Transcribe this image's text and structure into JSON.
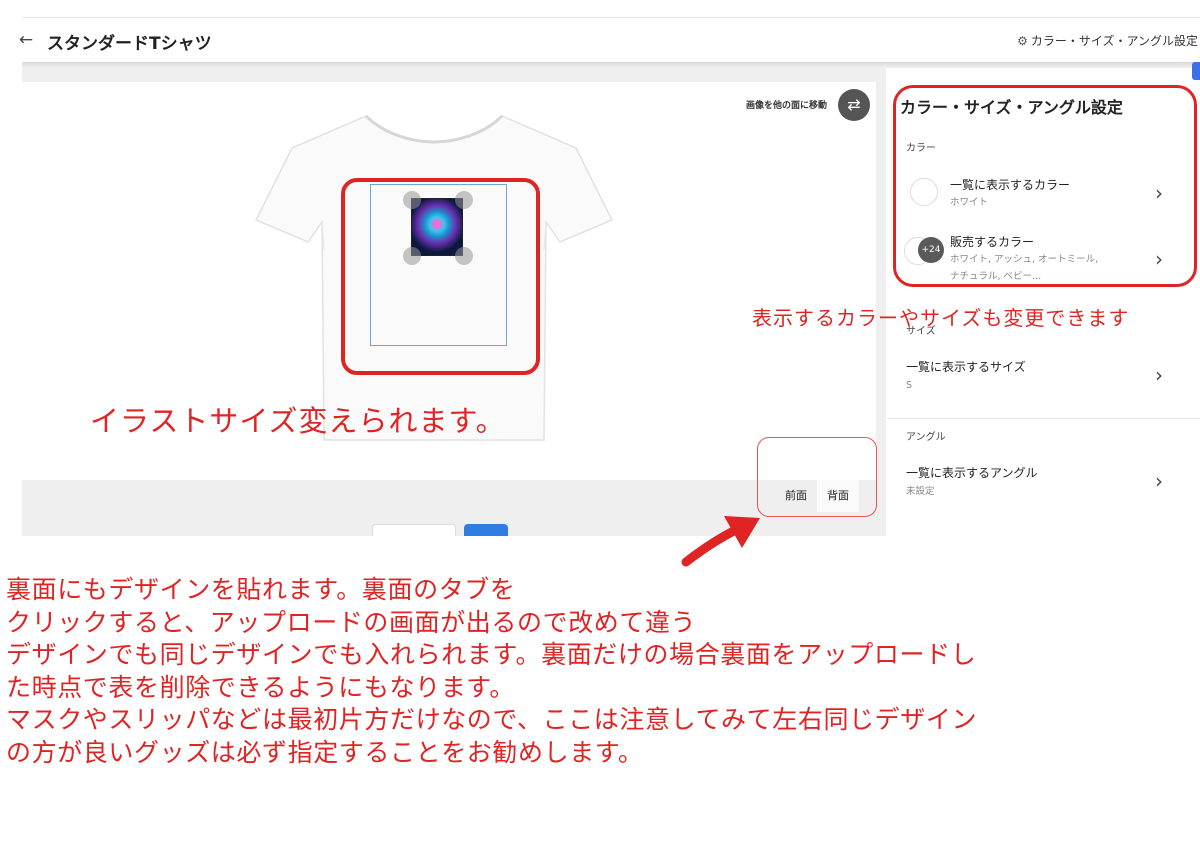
{
  "header": {
    "back_icon": "arrow-left-icon",
    "title": "スタンダードTシャツ",
    "settings_icon": "gear-icon",
    "settings_label": "カラー・サイズ・アングル設定"
  },
  "canvas": {
    "move_label": "画像を他の面に移動",
    "move_icon": "swap-arrows-icon",
    "tabs": [
      {
        "label": "前面",
        "active": false
      },
      {
        "label": "背面",
        "active": true
      }
    ]
  },
  "sidebar": {
    "title": "カラー・サイズ・アングル設定",
    "color": {
      "section_label": "カラー",
      "rows": [
        {
          "title": "一覧に表示するカラー",
          "value": "ホワイト"
        },
        {
          "title": "販売するカラー",
          "value": "ホワイト, アッシュ, オートミール, ナチュラル, ベビー...",
          "count_badge": "+24"
        }
      ]
    },
    "size": {
      "section_label": "サイズ",
      "row": {
        "title": "一覧に表示するサイズ",
        "value": "S"
      }
    },
    "angle": {
      "section_label": "アングル",
      "row": {
        "title": "一覧に表示するアングル",
        "value": "未設定"
      }
    }
  },
  "annotations": {
    "illust_size": "イラストサイズ変えられます。",
    "color_size_note": "表示するカラーやサイズも変更できます",
    "note_lines": [
      "裏面にもデザインを貼れます。裏面のタブを",
      "クリックすると、アップロードの画面が出るので改めて違う",
      "デザインでも同じデザインでも入れられます。裏面だけの場合裏面をアップロードし",
      "た時点で表を削除できるようにもなります。",
      "マスクやスリッパなどは最初片方だけなので、ここは注意してみて左右同じデザイン",
      "の方が良いグッズは必ず指定することをお勧めします。"
    ],
    "color": "#e02424"
  }
}
